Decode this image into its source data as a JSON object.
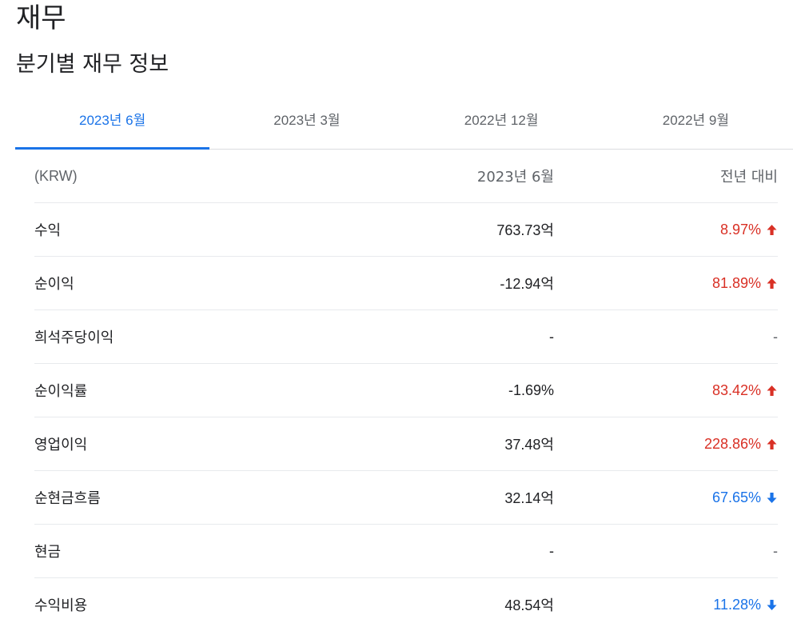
{
  "page": {
    "title": "재무",
    "subtitle": "분기별 재무 정보"
  },
  "tabs": [
    {
      "label": "2023년 6월",
      "active": true
    },
    {
      "label": "2023년 3월",
      "active": false
    },
    {
      "label": "2022년 12월",
      "active": false
    },
    {
      "label": "2022년 9월",
      "active": false
    }
  ],
  "table": {
    "header": {
      "currency": "(KRW)",
      "period": "2023년 6월",
      "change": "전년 대비"
    },
    "rows": [
      {
        "label": "수익",
        "value": "763.73억",
        "change": "8.97%",
        "direction": "up"
      },
      {
        "label": "순이익",
        "value": "-12.94억",
        "change": "81.89%",
        "direction": "up"
      },
      {
        "label": "희석주당이익",
        "value": "-",
        "change": "-",
        "direction": "none"
      },
      {
        "label": "순이익률",
        "value": "-1.69%",
        "change": "83.42%",
        "direction": "up"
      },
      {
        "label": "영업이익",
        "value": "37.48억",
        "change": "228.86%",
        "direction": "up"
      },
      {
        "label": "순현금흐름",
        "value": "32.14억",
        "change": "67.65%",
        "direction": "down"
      },
      {
        "label": "현금",
        "value": "-",
        "change": "-",
        "direction": "none"
      },
      {
        "label": "수익비용",
        "value": "48.54억",
        "change": "11.28%",
        "direction": "down"
      }
    ]
  },
  "colors": {
    "accent": "#1a73e8",
    "up": "#d93025",
    "down": "#1a73e8"
  },
  "icons": {
    "up": "arrow-up-icon",
    "down": "arrow-down-icon"
  }
}
